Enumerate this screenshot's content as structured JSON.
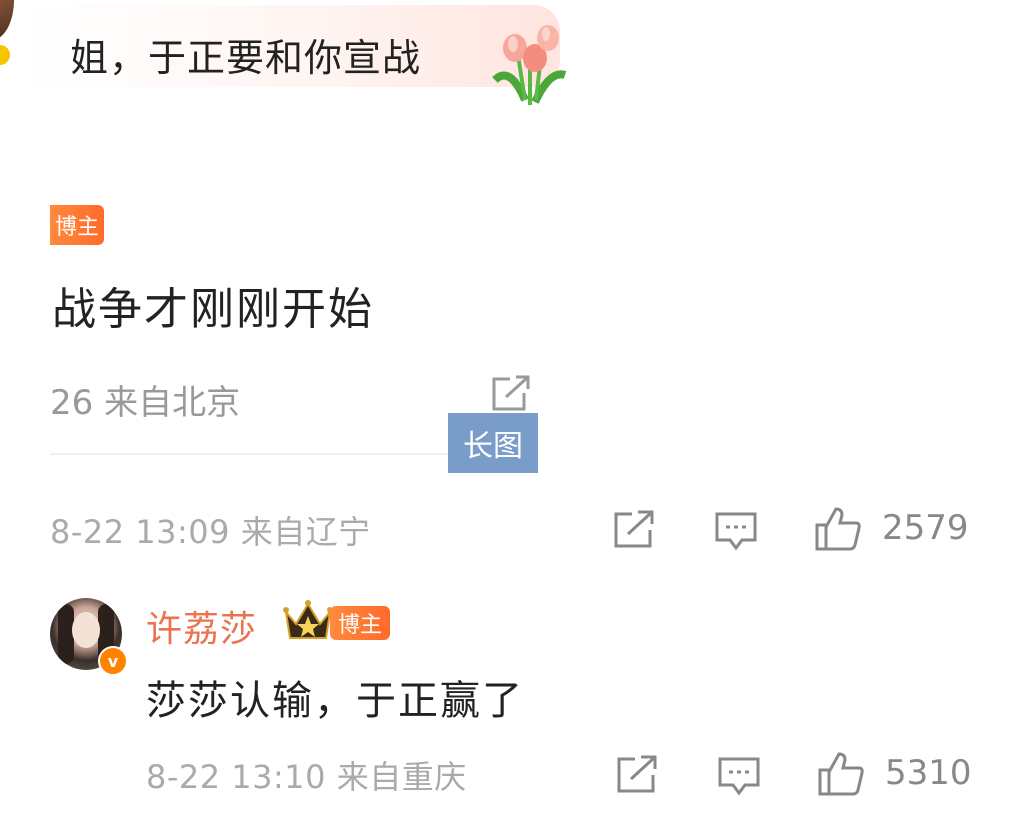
{
  "top_comment": {
    "text": "姐，于正要和你宣战",
    "sticker": "tulip-sticker"
  },
  "embedded_image": {
    "badge": "博主",
    "text": "战争才刚刚开始",
    "meta": "26 来自北京",
    "share_icon": "share-icon",
    "tag": "长图"
  },
  "first_comment_meta": {
    "time": "8-22 13:09 来自辽宁",
    "like_count": "2579",
    "icons": [
      "share-icon",
      "comment-icon",
      "thumbs-up-icon"
    ]
  },
  "reply": {
    "author": "许荔莎",
    "badge": "博主",
    "verified_mark": "v",
    "text": "莎莎认输，于正赢了",
    "time": "8-22 13:10 来自重庆",
    "like_count": "5310"
  },
  "colors": {
    "author_name": "#eb7350",
    "badge_orange": "#ff6a2a",
    "long_image_tag": "#7a9cc8",
    "meta_gray": "#aaaaaa"
  }
}
